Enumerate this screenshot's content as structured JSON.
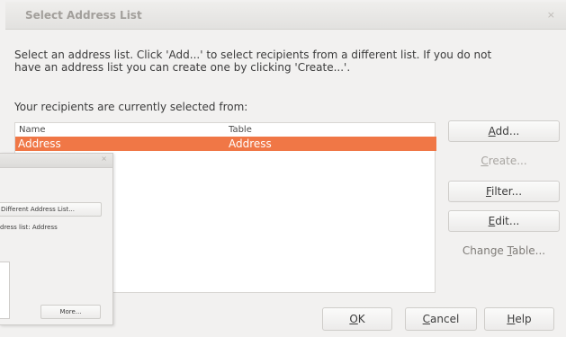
{
  "dialog": {
    "title": "Select Address List",
    "close_glyph": "×",
    "intro_line1": "Select an address list. Click 'Add...' to select recipients from a different list. If you do not",
    "intro_line2": "have an address list you can create one by clicking 'Create...'.",
    "recipients_label": "Your recipients are currently selected from:",
    "list": {
      "columns": [
        "Name",
        "Table"
      ],
      "rows": [
        {
          "name": "Address",
          "table": "Address",
          "selected": true
        }
      ],
      "selection_color": "#f07746"
    },
    "side_buttons": {
      "add": {
        "mn": "A",
        "rest": "dd..."
      },
      "create": {
        "mn": "C",
        "rest": "reate..."
      },
      "filter": {
        "mn": "F",
        "rest": "ilter..."
      },
      "edit": {
        "mn": "E",
        "rest": "dit..."
      },
      "change_table": {
        "pre": "Change ",
        "mn": "T",
        "rest": "able..."
      }
    },
    "bottom_buttons": {
      "ok": {
        "mn": "O",
        "rest": "K"
      },
      "cancel": {
        "mn": "C",
        "rest": "ancel"
      },
      "help": {
        "mn": "H",
        "rest": "elp"
      }
    }
  },
  "background_dialog": {
    "close_glyph": "×",
    "select_button": "Different Address List...",
    "current_list_text": "dress list: Address",
    "more_button": "More..."
  }
}
